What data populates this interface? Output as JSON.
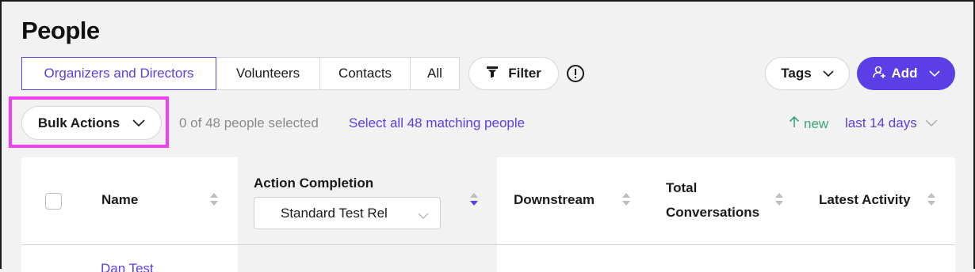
{
  "page": {
    "title": "People"
  },
  "tabs": [
    {
      "label": "Organizers and Directors",
      "active": true
    },
    {
      "label": "Volunteers",
      "active": false
    },
    {
      "label": "Contacts",
      "active": false
    },
    {
      "label": "All",
      "active": false
    }
  ],
  "toolbar": {
    "filter_label": "Filter",
    "tags_label": "Tags",
    "add_label": "Add"
  },
  "bulk": {
    "button_label": "Bulk Actions",
    "selected_text": "0 of 48 people selected",
    "select_all_text": "Select all 48 matching people"
  },
  "activity": {
    "new_label": "new",
    "range_label": "last 14 days"
  },
  "table": {
    "columns": {
      "name": "Name",
      "action_completion": "Action Completion",
      "downstream": "Downstream",
      "total_conversations_line1": "Total",
      "total_conversations_line2": "Conversations",
      "latest_activity": "Latest Activity"
    },
    "action_dropdown_value": "Standard Test Rel",
    "first_row_name": "Dan Test"
  },
  "colors": {
    "accent": "#5b3ee6",
    "highlight": "#f23ff0",
    "new_green": "#3ba57a"
  }
}
